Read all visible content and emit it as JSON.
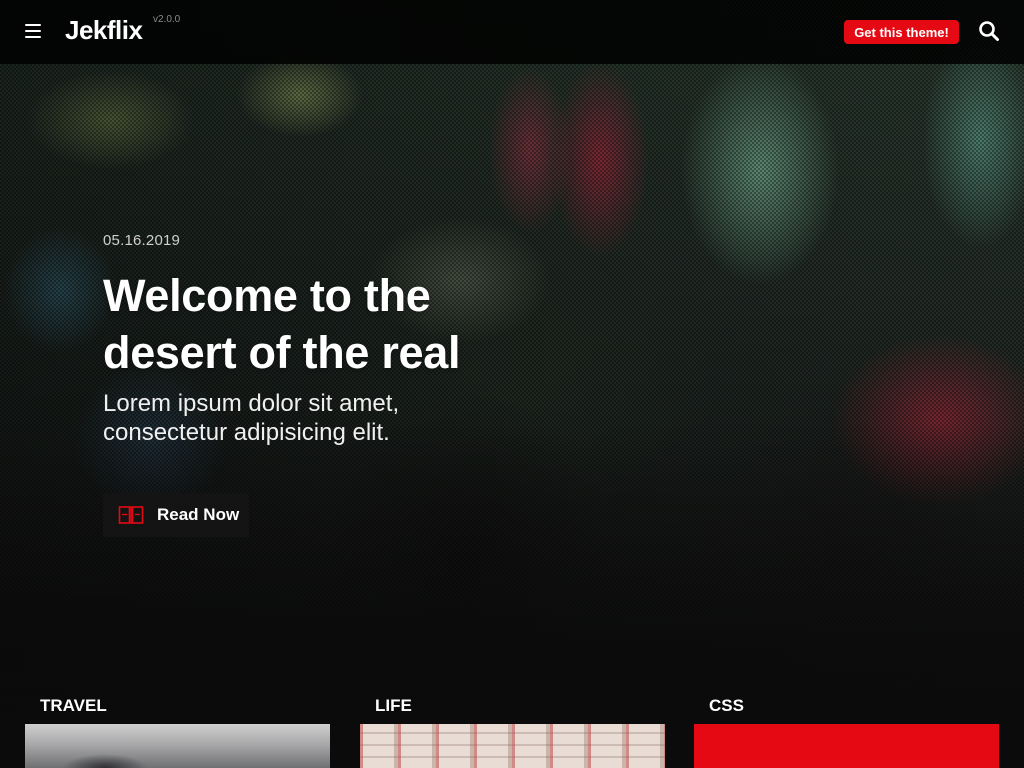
{
  "header": {
    "logo": "Jekflix",
    "version": "v2.0.0",
    "cta_label": "Get this theme!",
    "icons": {
      "menu": "hamburger-menu-icon",
      "search": "search-icon"
    }
  },
  "hero": {
    "date": "05.16.2019",
    "title_line1": "Welcome to the",
    "title_line2": "desert of the real",
    "subtitle_line1": "Lorem ipsum dolor sit amet,",
    "subtitle_line2": "consectetur adipisicing elit.",
    "read_label": "Read Now",
    "read_icon": "book-open-icon"
  },
  "categories": [
    {
      "label": "TRAVEL"
    },
    {
      "label": "LIFE"
    },
    {
      "label": "CSS"
    }
  ],
  "colors": {
    "accent": "#e50914",
    "header_bg": "#000000",
    "text": "#ffffff",
    "muted": "#8a8a8a"
  }
}
